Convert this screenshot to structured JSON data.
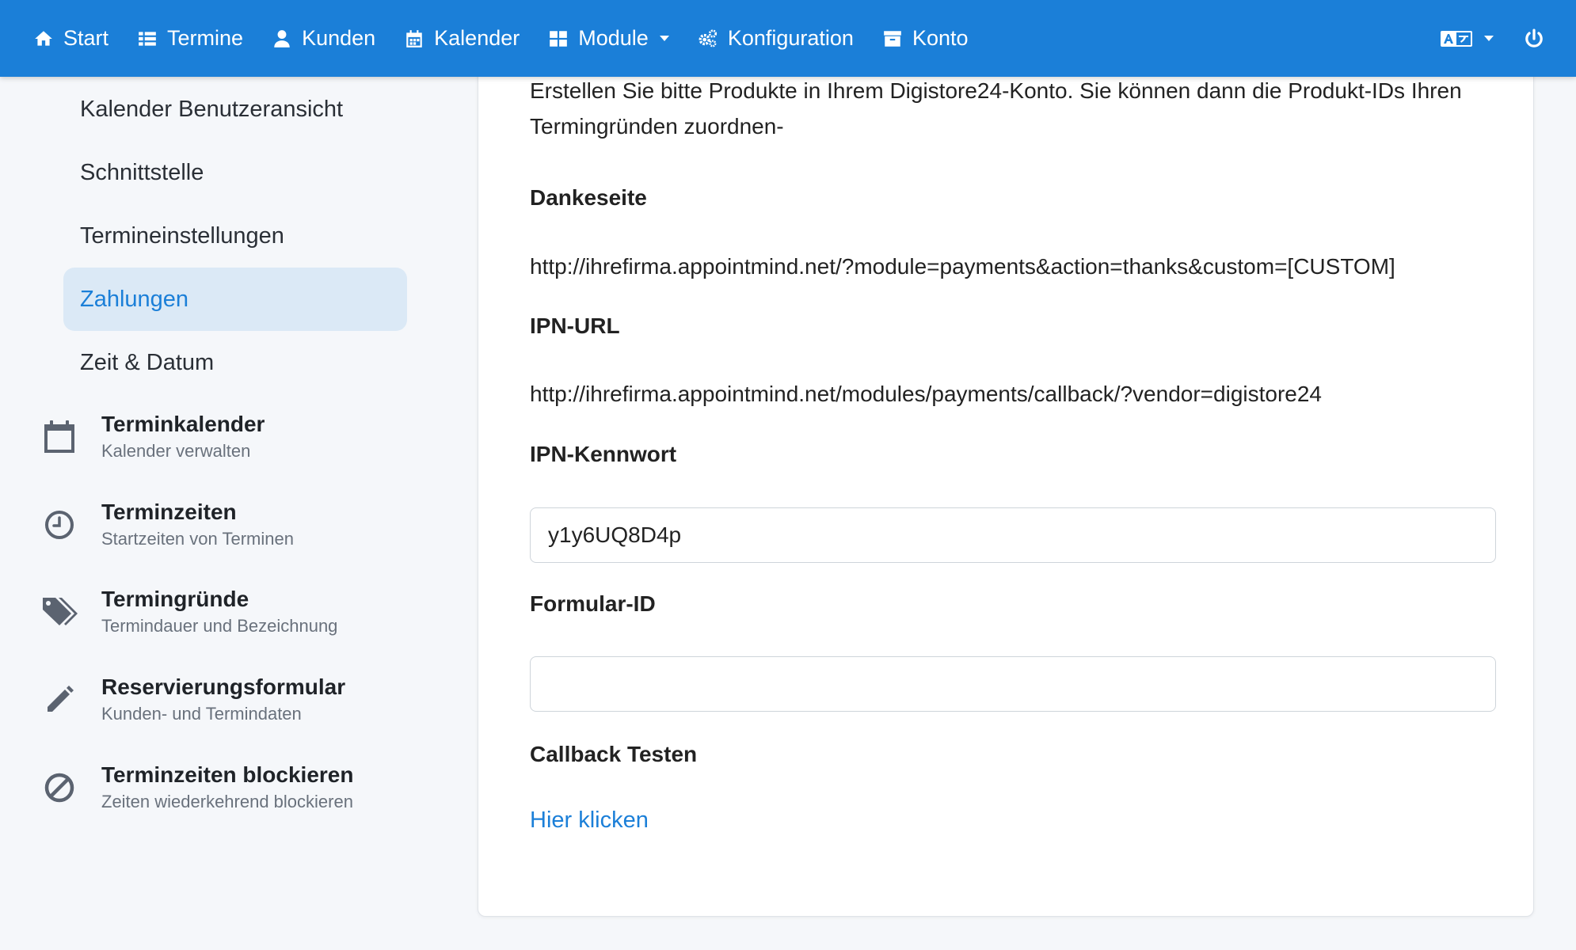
{
  "nav": {
    "items": [
      {
        "label": "Start",
        "icon": "home-icon"
      },
      {
        "label": "Termine",
        "icon": "list-icon"
      },
      {
        "label": "Kunden",
        "icon": "user-icon"
      },
      {
        "label": "Kalender",
        "icon": "calendar-icon"
      },
      {
        "label": "Module",
        "icon": "grid-icon"
      },
      {
        "label": "Konfiguration",
        "icon": "gears-icon"
      },
      {
        "label": "Konto",
        "icon": "archive-icon"
      }
    ]
  },
  "sidebar": {
    "sub_items": [
      {
        "label": "Kalender Benutzeransicht"
      },
      {
        "label": "Schnittstelle"
      },
      {
        "label": "Termineinstellungen"
      },
      {
        "label": "Zahlungen",
        "active": true
      },
      {
        "label": "Zeit & Datum"
      }
    ],
    "main_items": [
      {
        "title": "Terminkalender",
        "subtitle": "Kalender verwalten",
        "icon": "calendar-icon"
      },
      {
        "title": "Terminzeiten",
        "subtitle": "Startzeiten von Terminen",
        "icon": "clock-icon"
      },
      {
        "title": "Termingründe",
        "subtitle": "Termindauer und Bezeichnung",
        "icon": "tags-icon"
      },
      {
        "title": "Reservierungsformular",
        "subtitle": "Kunden- und Termindaten",
        "icon": "pencil-icon"
      },
      {
        "title": "Terminzeiten blockieren",
        "subtitle": "Zeiten wiederkehrend blockieren",
        "icon": "ban-icon"
      }
    ]
  },
  "content": {
    "intro": "Erstellen Sie bitte Produkte in Ihrem Digistore24-Konto. Sie können dann die Produkt-IDs Ihren Termingründen zuordnen-",
    "thanks_label": "Dankeseite",
    "thanks_url": "http://ihrefirma.appointmind.net/?module=payments&action=thanks&custom=[CUSTOM]",
    "ipn_label": "IPN-URL",
    "ipn_url": "http://ihrefirma.appointmind.net/modules/payments/callback/?vendor=digistore24",
    "ipn_password_label": "IPN-Kennwort",
    "ipn_password_value": "y1y6UQ8D4p",
    "form_id_label": "Formular-ID",
    "form_id_value": "",
    "callback_label": "Callback Testen",
    "callback_link": "Hier klicken"
  },
  "colors": {
    "primary": "#1b7fd8",
    "active_bg": "#dbe9f6"
  }
}
